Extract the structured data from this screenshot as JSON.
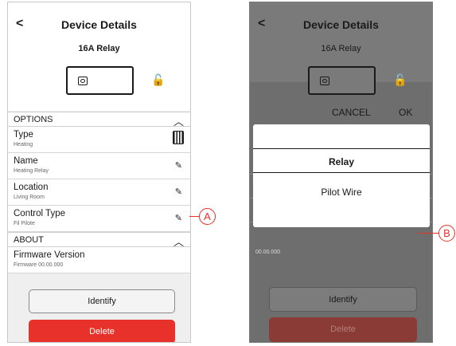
{
  "left": {
    "back_glyph": "<",
    "title": "Device Details",
    "subtitle": "16A Relay",
    "options_label": "OPTIONS",
    "about_label": "ABOUT",
    "rows": [
      {
        "name": "Type",
        "value": "Heating",
        "icon": "radiator-icon"
      },
      {
        "name": "Name",
        "value": "Heating Relay",
        "icon": "pencil-icon"
      },
      {
        "name": "Location",
        "value": "Living Room",
        "icon": "pencil-icon"
      },
      {
        "name": "Control Type",
        "value": "Fil Pilote",
        "icon": "pencil-icon"
      }
    ],
    "firmware": {
      "name": "Firmware Version",
      "value": "Firmware 00.00.000"
    },
    "identify_label": "Identify",
    "delete_label": "Delete"
  },
  "right": {
    "back_glyph": "<",
    "title": "Device Details",
    "subtitle": "16A Relay",
    "timestamp": "00.00.000",
    "identify_label": "Identify",
    "delete_label": "Delete",
    "dialog": {
      "title": "Relay",
      "option": "Pilot Wire",
      "cancel_label": "CANCEL",
      "ok_label": "OK"
    }
  },
  "callouts": {
    "a": "A",
    "b": "B"
  },
  "colors": {
    "accent_red": "#e8312a",
    "overlay": "#6e6e6e"
  }
}
